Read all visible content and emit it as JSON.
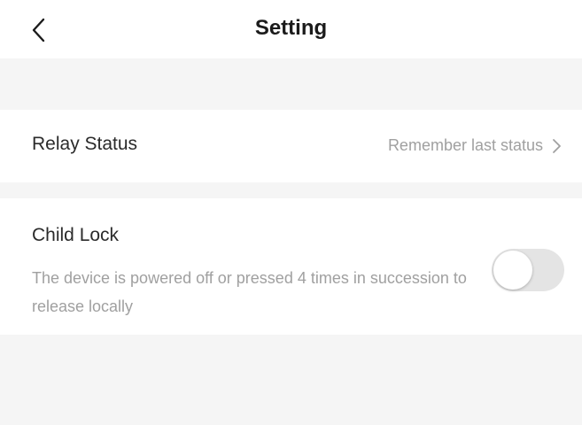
{
  "header": {
    "title": "Setting",
    "back_icon": "chevron-left-icon"
  },
  "settings": {
    "relay_status": {
      "label": "Relay Status",
      "value": "Remember last status",
      "chevron_icon": "chevron-right-icon"
    },
    "child_lock": {
      "label": "Child Lock",
      "description": "The device is powered off or pressed 4 times in succession to release locally",
      "enabled": false
    }
  },
  "colors": {
    "background": "#f5f5f5",
    "card": "#ffffff",
    "title": "#1b1b1b",
    "secondary_text": "#a0a0a0",
    "toggle_off": "#e4e4e4"
  }
}
